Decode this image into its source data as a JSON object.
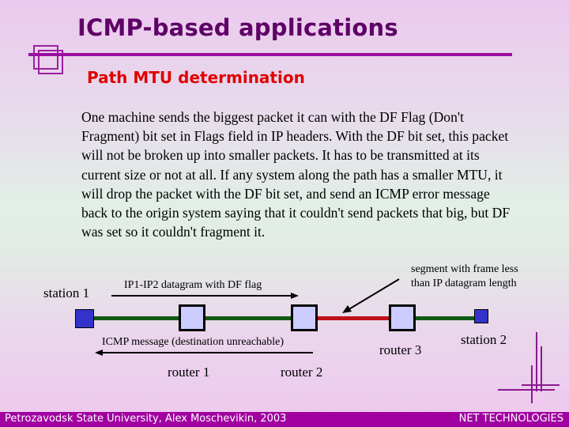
{
  "slide": {
    "title": "ICMP-based applications",
    "subtitle": "Path MTU determination",
    "body": "One machine sends the biggest packet it can with the DF Flag (Don't Fragment) bit set in Flags field in IP headers. With the DF bit set, this packet will not be broken up into smaller packets. It has to be transmitted at its current size or not at all. If any system along the path has a smaller MTU, it will drop the packet with the DF bit set, and send an ICMP error message back to the origin system saying that it couldn't send packets that big, but DF was set so it couldn't fragment it."
  },
  "diagram": {
    "station1": "station 1",
    "station2": "station 2",
    "router1": "router 1",
    "router2": "router 2",
    "router3": "router 3",
    "forward_arrow_label": "IP1-IP2 datagram with DF flag",
    "back_arrow_label": "ICMP message (destination unreachable)",
    "segment_note_line1": "segment with frame less",
    "segment_note_line2": "than IP datagram length",
    "colors": {
      "normal_link": "#0f5a14",
      "small_mtu_link": "#c0101a",
      "router_fill": "#ccccff",
      "station_fill": "#3333cc"
    }
  },
  "footer": {
    "left": "Petrozavodsk State University, Alex Moschevikin, 2003",
    "right": "NET TECHNOLOGIES"
  }
}
